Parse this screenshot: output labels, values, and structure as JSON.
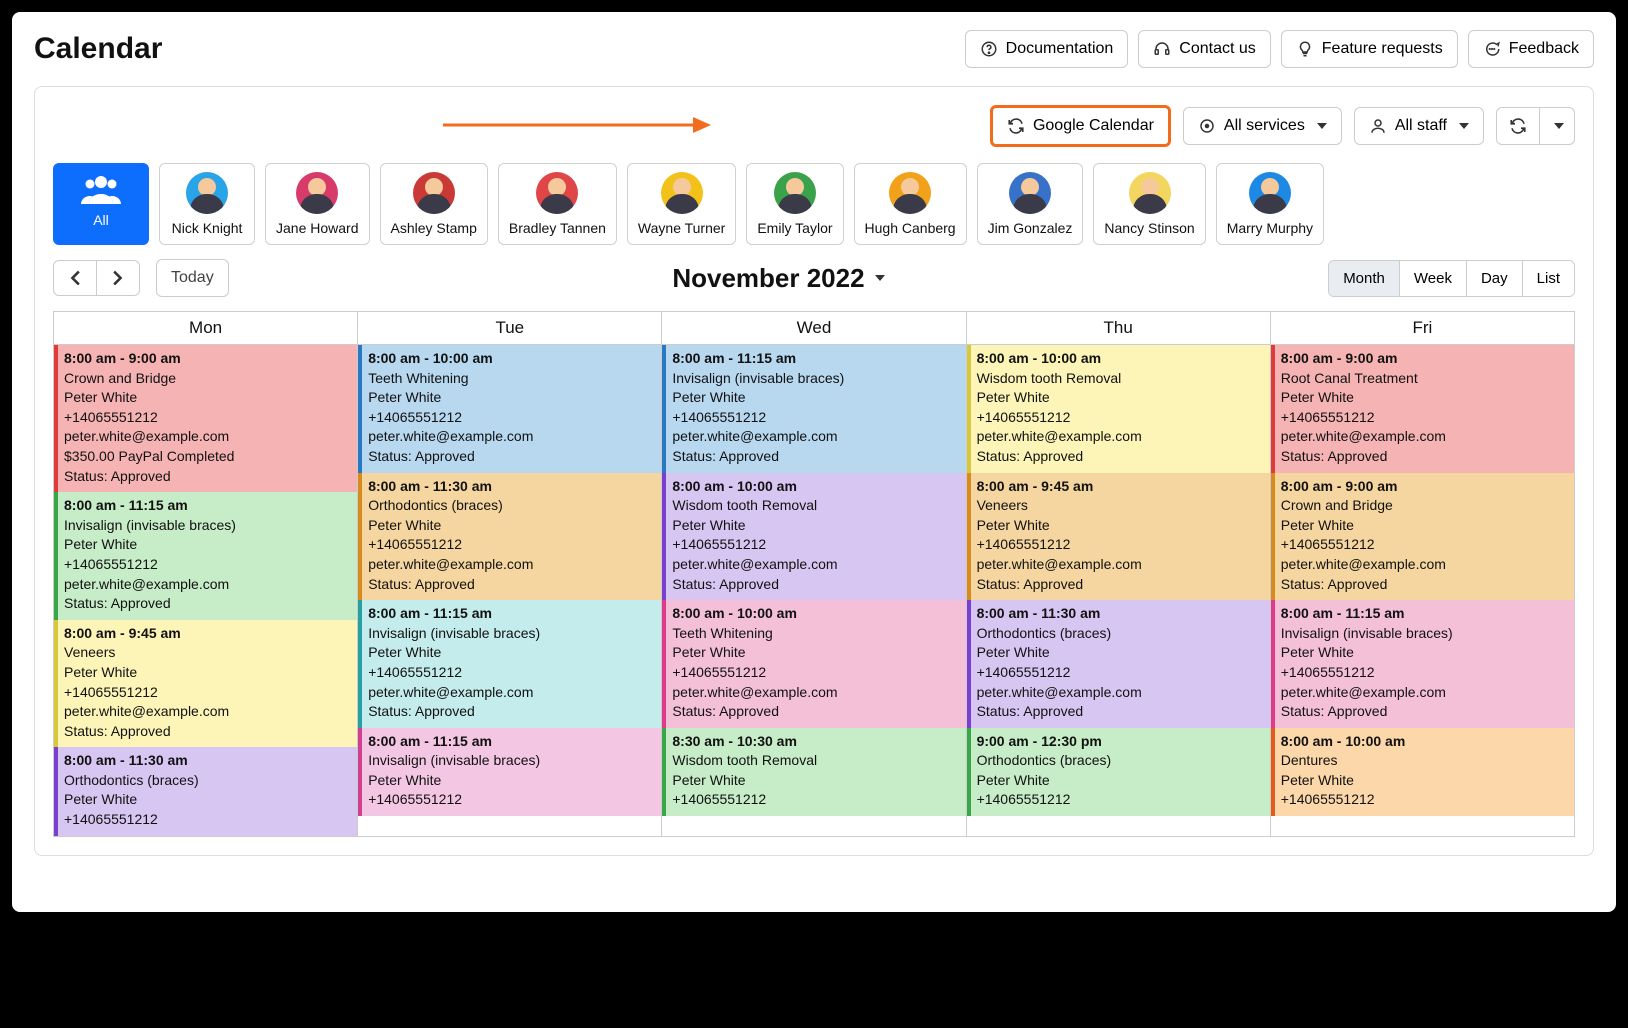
{
  "header": {
    "title": "Calendar",
    "buttons": {
      "documentation": "Documentation",
      "contact": "Contact us",
      "features": "Feature requests",
      "feedback": "Feedback"
    }
  },
  "toolbar": {
    "google_calendar": "Google Calendar",
    "all_services": "All services",
    "all_staff": "All staff"
  },
  "staff": [
    {
      "name": "All",
      "active": true,
      "color": "#0d6efd"
    },
    {
      "name": "Nick Knight",
      "color": "#2aa4e8"
    },
    {
      "name": "Jane Howard",
      "color": "#d83b6a"
    },
    {
      "name": "Ashley Stamp",
      "color": "#c93a37"
    },
    {
      "name": "Bradley Tannen",
      "color": "#e04648"
    },
    {
      "name": "Wayne Turner",
      "color": "#f2c11a"
    },
    {
      "name": "Emily Taylor",
      "color": "#3aa24a"
    },
    {
      "name": "Hugh Canberg",
      "color": "#f2a21a"
    },
    {
      "name": "Jim Gonzalez",
      "color": "#3771c8"
    },
    {
      "name": "Nancy Stinson",
      "color": "#f3d660"
    },
    {
      "name": "Marry Murphy",
      "color": "#1e88e5"
    }
  ],
  "nav": {
    "today": "Today",
    "month_label": "November 2022",
    "views": {
      "month": "Month",
      "week": "Week",
      "day": "Day",
      "list": "List"
    },
    "active_view": "month"
  },
  "days": [
    "Mon",
    "Tue",
    "Wed",
    "Thu",
    "Fri"
  ],
  "client": {
    "name": "Peter White",
    "phone": "+14065551212",
    "email": "peter.white@example.com"
  },
  "status_approved": "Status: Approved",
  "payment_line": "$350.00 PayPal Completed",
  "grid": [
    [
      {
        "time": "8:00 am - 9:00 am",
        "service": "Crown and Bridge",
        "bg": "#f6b3b3",
        "bar": "#e03a3a",
        "payment": true
      },
      {
        "time": "8:00 am - 11:15 am",
        "service": "Invisalign (invisable braces)",
        "bg": "#c7ecc8",
        "bar": "#38a745"
      },
      {
        "time": "8:00 am - 9:45 am",
        "service": "Veneers",
        "bg": "#fdf4b7",
        "bar": "#d7c93b"
      },
      {
        "time": "8:00 am - 11:30 am",
        "service": "Orthodontics (braces)",
        "bg": "#d8c6f2",
        "bar": "#7a3fd1",
        "truncated": true
      }
    ],
    [
      {
        "time": "8:00 am - 10:00 am",
        "service": "Teeth Whitening",
        "bg": "#b8d8f0",
        "bar": "#2a78c2"
      },
      {
        "time": "8:00 am - 11:30 am",
        "service": "Orthodontics (braces)",
        "bg": "#f6d6a0",
        "bar": "#d68b1c"
      },
      {
        "time": "8:00 am - 11:15 am",
        "service": "Invisalign (invisable braces)",
        "bg": "#c5ecec",
        "bar": "#26a0a0"
      },
      {
        "time": "8:00 am - 11:15 am",
        "service": "Invisalign (invisable braces)",
        "bg": "#f3c7e3",
        "bar": "#d13f8f",
        "truncated": true
      }
    ],
    [
      {
        "time": "8:00 am - 11:15 am",
        "service": "Invisalign (invisable braces)",
        "bg": "#b8d8f0",
        "bar": "#2a78c2"
      },
      {
        "time": "8:00 am - 10:00 am",
        "service": "Wisdom tooth Removal",
        "bg": "#d8c6f2",
        "bar": "#7a3fd1"
      },
      {
        "time": "8:00 am - 10:00 am",
        "service": "Teeth Whitening",
        "bg": "#f4c0d8",
        "bar": "#e03a8a"
      },
      {
        "time": "8:30 am - 10:30 am",
        "service": "Wisdom tooth Removal",
        "bg": "#c7ecc8",
        "bar": "#38a745",
        "truncated": true
      }
    ],
    [
      {
        "time": "8:00 am - 10:00 am",
        "service": "Wisdom tooth Removal",
        "bg": "#fdf4b7",
        "bar": "#d7c93b"
      },
      {
        "time": "8:00 am - 9:45 am",
        "service": "Veneers",
        "bg": "#f6d6a0",
        "bar": "#d68b1c"
      },
      {
        "time": "8:00 am - 11:30 am",
        "service": "Orthodontics (braces)",
        "bg": "#d8c6f2",
        "bar": "#7a3fd1"
      },
      {
        "time": "9:00 am - 12:30 pm",
        "service": "Orthodontics (braces)",
        "bg": "#c7ecc8",
        "bar": "#38a745",
        "truncated": true
      }
    ],
    [
      {
        "time": "8:00 am - 9:00 am",
        "service": "Root Canal Treatment",
        "bg": "#f6b3b3",
        "bar": "#e03a3a"
      },
      {
        "time": "8:00 am - 9:00 am",
        "service": "Crown and Bridge",
        "bg": "#f6d6a0",
        "bar": "#d68b1c"
      },
      {
        "time": "8:00 am - 11:15 am",
        "service": "Invisalign (invisable braces)",
        "bg": "#f4c0d8",
        "bar": "#e03a8a"
      },
      {
        "time": "8:00 am - 10:00 am",
        "service": "Dentures",
        "bg": "#fbd7a9",
        "bar": "#e35a1c",
        "truncated": true
      }
    ]
  ]
}
